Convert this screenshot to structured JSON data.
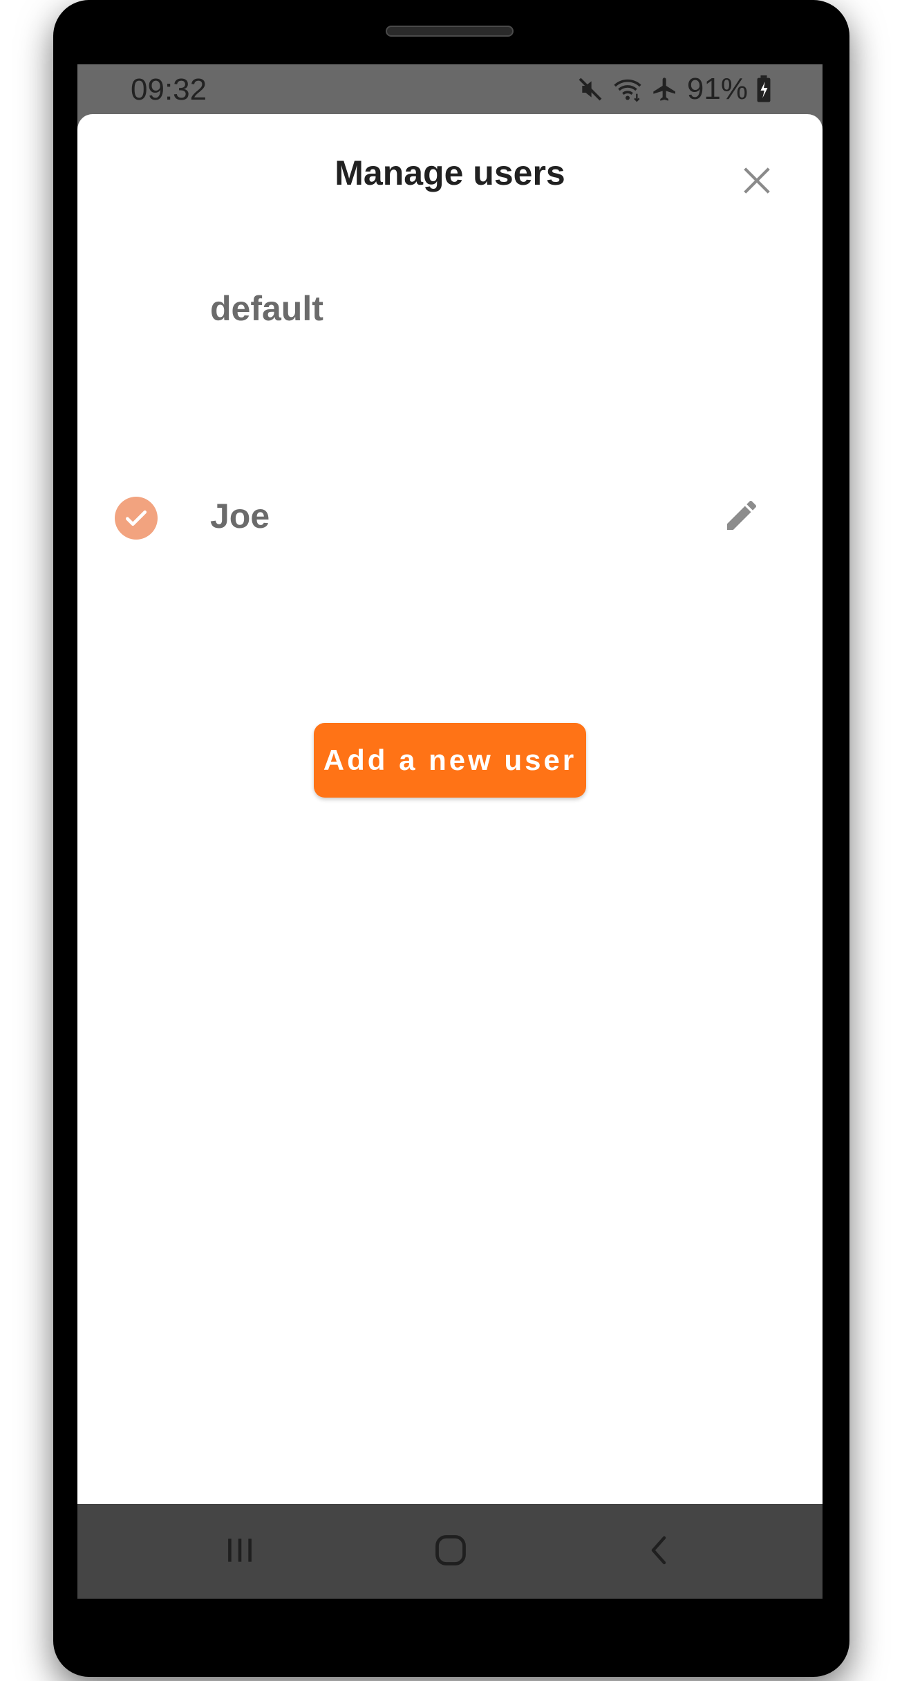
{
  "status_bar": {
    "time": "09:32",
    "battery_percent": "91%",
    "icons": [
      "mute-icon",
      "wifi-icon",
      "airplane-icon",
      "battery-charging-icon"
    ]
  },
  "sheet": {
    "title": "Manage users",
    "close_icon": "close-icon"
  },
  "users": [
    {
      "name": "default",
      "selected": false,
      "editable": false
    },
    {
      "name": "Joe",
      "selected": true,
      "editable": true
    }
  ],
  "add_button": {
    "label": "Add a new user"
  },
  "nav_bar": {
    "icons": [
      "recent-apps-icon",
      "home-icon",
      "back-icon"
    ]
  },
  "colors": {
    "accent": "#ff7316",
    "check_circle": "#f2a37f",
    "status_background": "#696969",
    "nav_background": "#454545",
    "name_text": "#6b6b6b"
  }
}
